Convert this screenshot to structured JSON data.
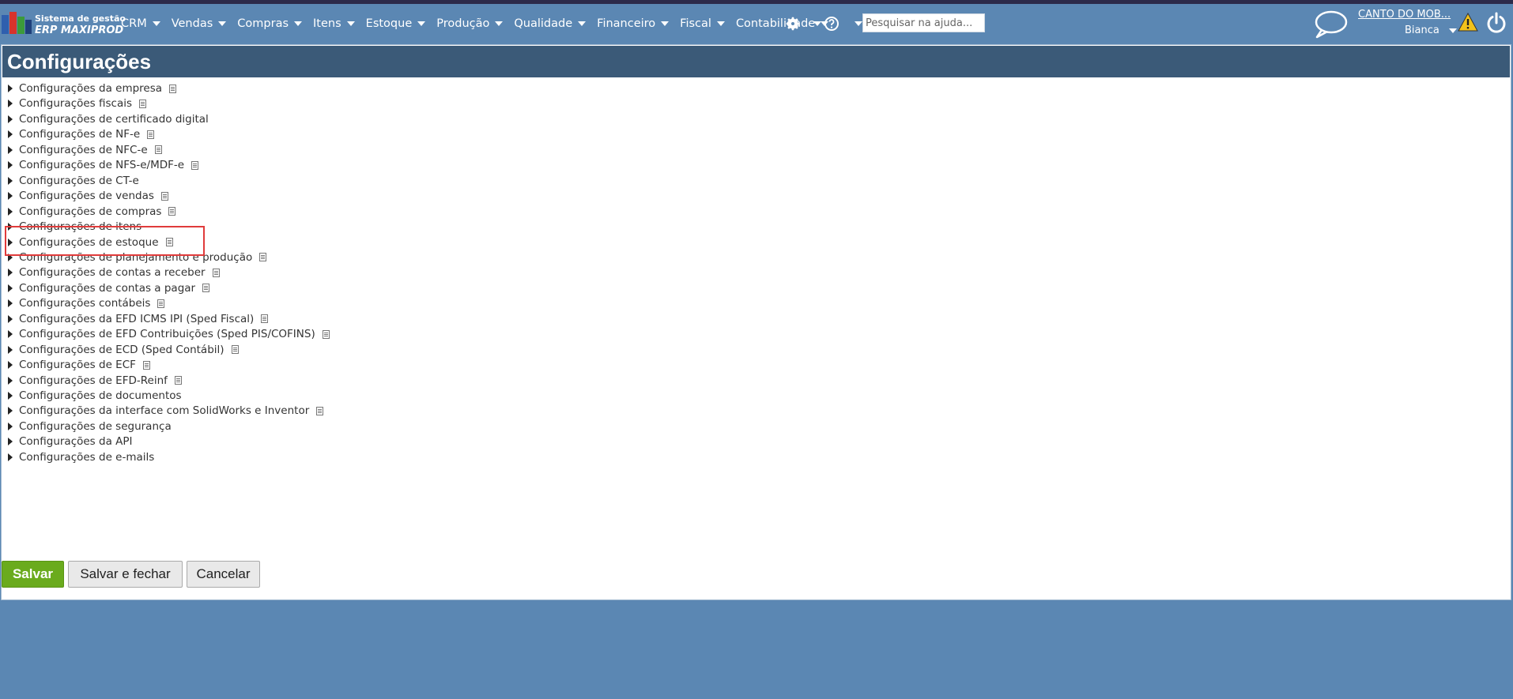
{
  "app": {
    "logo_line1": "Sistema de gestão",
    "logo_line2": "ERP MAXIPROD"
  },
  "menu": [
    {
      "label": "CRM"
    },
    {
      "label": "Vendas"
    },
    {
      "label": "Compras"
    },
    {
      "label": "Itens"
    },
    {
      "label": "Estoque"
    },
    {
      "label": "Produção"
    },
    {
      "label": "Qualidade"
    },
    {
      "label": "Financeiro"
    },
    {
      "label": "Fiscal"
    },
    {
      "label": "Contabilidade"
    }
  ],
  "search": {
    "placeholder": "Pesquisar na ajuda..."
  },
  "account": {
    "company": "CANTO DO MOB...",
    "user": "Bianca"
  },
  "page": {
    "title": "Configurações"
  },
  "config_items": [
    {
      "label": "Configurações da empresa",
      "doc": true
    },
    {
      "label": "Configurações fiscais",
      "doc": true
    },
    {
      "label": "Configurações de certificado digital",
      "doc": false
    },
    {
      "label": "Configurações de NF-e",
      "doc": true
    },
    {
      "label": "Configurações de NFC-e",
      "doc": true
    },
    {
      "label": "Configurações de NFS-e/MDF-e",
      "doc": true
    },
    {
      "label": "Configurações de CT-e",
      "doc": false
    },
    {
      "label": "Configurações de vendas",
      "doc": true
    },
    {
      "label": "Configurações de compras",
      "doc": true
    },
    {
      "label": "Configurações de itens",
      "doc": false
    },
    {
      "label": "Configurações de estoque",
      "doc": true
    },
    {
      "label": "Configurações de planejamento e produção",
      "doc": true
    },
    {
      "label": "Configurações de contas a receber",
      "doc": true
    },
    {
      "label": "Configurações de contas a pagar",
      "doc": true
    },
    {
      "label": "Configurações contábeis",
      "doc": true
    },
    {
      "label": "Configurações da EFD ICMS IPI (Sped Fiscal)",
      "doc": true
    },
    {
      "label": "Configurações de EFD Contribuições (Sped PIS/COFINS)",
      "doc": true
    },
    {
      "label": "Configurações de ECD (Sped Contábil)",
      "doc": true
    },
    {
      "label": "Configurações de ECF",
      "doc": true
    },
    {
      "label": "Configurações de EFD-Reinf",
      "doc": true
    },
    {
      "label": "Configurações de documentos",
      "doc": false
    },
    {
      "label": "Configurações da interface com SolidWorks e Inventor",
      "doc": true
    },
    {
      "label": "Configurações de segurança",
      "doc": false
    },
    {
      "label": "Configurações da API",
      "doc": false
    },
    {
      "label": "Configurações de e-mails",
      "doc": false
    }
  ],
  "buttons": {
    "save": "Salvar",
    "save_close": "Salvar e fechar",
    "cancel": "Cancelar"
  },
  "colors": {
    "topbar": "#5b87b3",
    "title_bar": "#3b5a78",
    "save_button": "#6aab1d",
    "highlight": "#e03b3b"
  }
}
